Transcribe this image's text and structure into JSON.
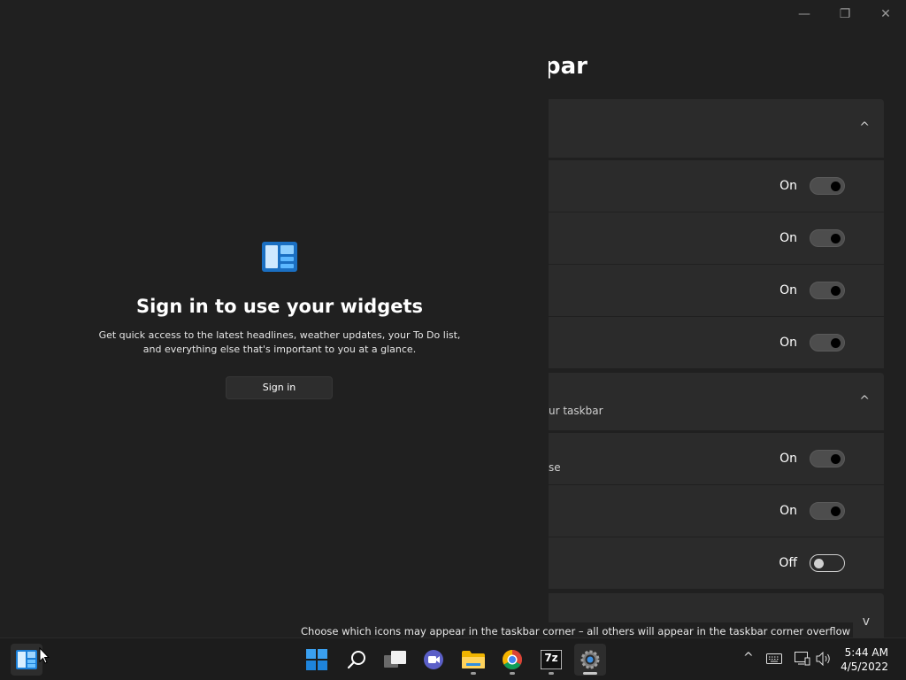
{
  "settings": {
    "title_fragment": "par",
    "window_controls": {
      "minimize": "—",
      "maximize": "❐",
      "close": "✕"
    },
    "group1": {
      "chevron": "^",
      "rows": [
        {
          "status": "On",
          "state": "on"
        },
        {
          "status": "On",
          "state": "on"
        },
        {
          "status": "On",
          "state": "on"
        },
        {
          "status": "On",
          "state": "on"
        }
      ]
    },
    "group2": {
      "subtitle_fragment": "ur taskbar",
      "chevron": "^",
      "rows": [
        {
          "status": "On",
          "state": "on",
          "sub_fragment": "se"
        },
        {
          "status": "On",
          "state": "on"
        },
        {
          "status": "Off",
          "state": "off"
        }
      ]
    },
    "group3": {
      "chevron": "v"
    }
  },
  "widgets": {
    "title": "Sign in to use your widgets",
    "description": "Get quick access to the latest headlines, weather updates, your To Do list, and everything else that's important to you at a glance.",
    "sign_in_label": "Sign in"
  },
  "tooltip": "Choose which icons may appear in the taskbar corner – all others will appear in the taskbar corner overflow menu",
  "taskbar": {
    "icons": [
      "widgets-icon",
      "start-icon",
      "search-icon",
      "task-view-icon",
      "chat-icon",
      "file-explorer-icon",
      "chrome-icon",
      "7zip-icon",
      "settings-icon"
    ],
    "zip_label": "7z",
    "tray": {
      "overflow": "^"
    },
    "clock": {
      "time": "5:44 AM",
      "date": "4/5/2022"
    }
  }
}
